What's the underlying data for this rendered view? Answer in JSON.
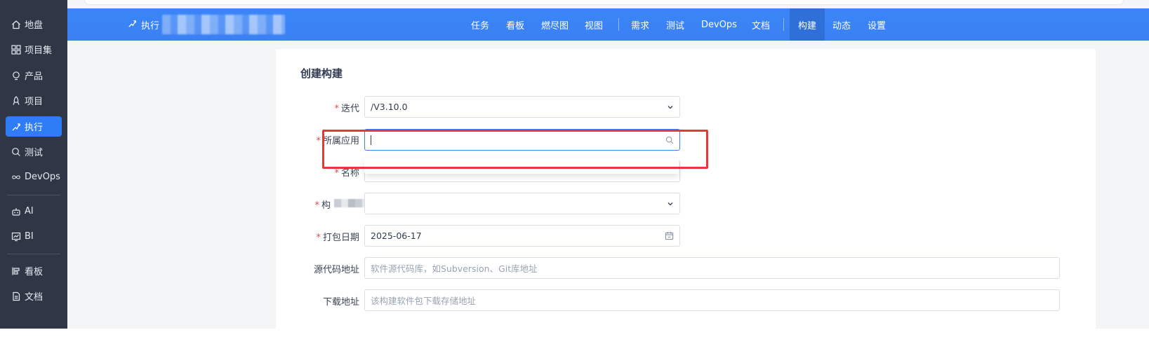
{
  "sidebar": {
    "items": [
      {
        "label": "地盘",
        "icon": "home-icon"
      },
      {
        "label": "项目集",
        "icon": "grid-icon"
      },
      {
        "label": "产品",
        "icon": "bulb-icon"
      },
      {
        "label": "项目",
        "icon": "rocket-icon"
      },
      {
        "label": "执行",
        "icon": "run-icon",
        "active": true
      },
      {
        "label": "测试",
        "icon": "search-icon"
      },
      {
        "label": "DevOps",
        "icon": "infinity-icon"
      },
      {
        "label": "AI",
        "icon": "robot-icon"
      },
      {
        "label": "BI",
        "icon": "chart-icon"
      },
      {
        "label": "看板",
        "icon": "kanban-icon"
      },
      {
        "label": "文档",
        "icon": "doc-icon"
      }
    ]
  },
  "header": {
    "crumb_label": "执行",
    "nav": [
      "任务",
      "看板",
      "燃尽图",
      "视图",
      "需求",
      "测试",
      "DevOps",
      "文档",
      "构建",
      "动态",
      "设置"
    ],
    "active_nav": "构建"
  },
  "form": {
    "title": "创建构建",
    "iteration": {
      "label": "迭代",
      "value": "/V3.10.0"
    },
    "app": {
      "label": "所属应用",
      "value": ""
    },
    "name": {
      "label": "名称",
      "value": ""
    },
    "builder": {
      "label": "构"
    },
    "date": {
      "label": "打包日期",
      "value": "2025-06-17"
    },
    "source": {
      "label": "源代码地址",
      "placeholder": "软件源代码库，如Subversion、Git库地址"
    },
    "download": {
      "label": "下载地址",
      "placeholder": "该构建软件包下载存储地址"
    }
  },
  "colors": {
    "sidebar_bg": "#2f3747",
    "header_bg": "#3b82f6",
    "active": "#2e7cf6",
    "highlight": "#e53935"
  }
}
